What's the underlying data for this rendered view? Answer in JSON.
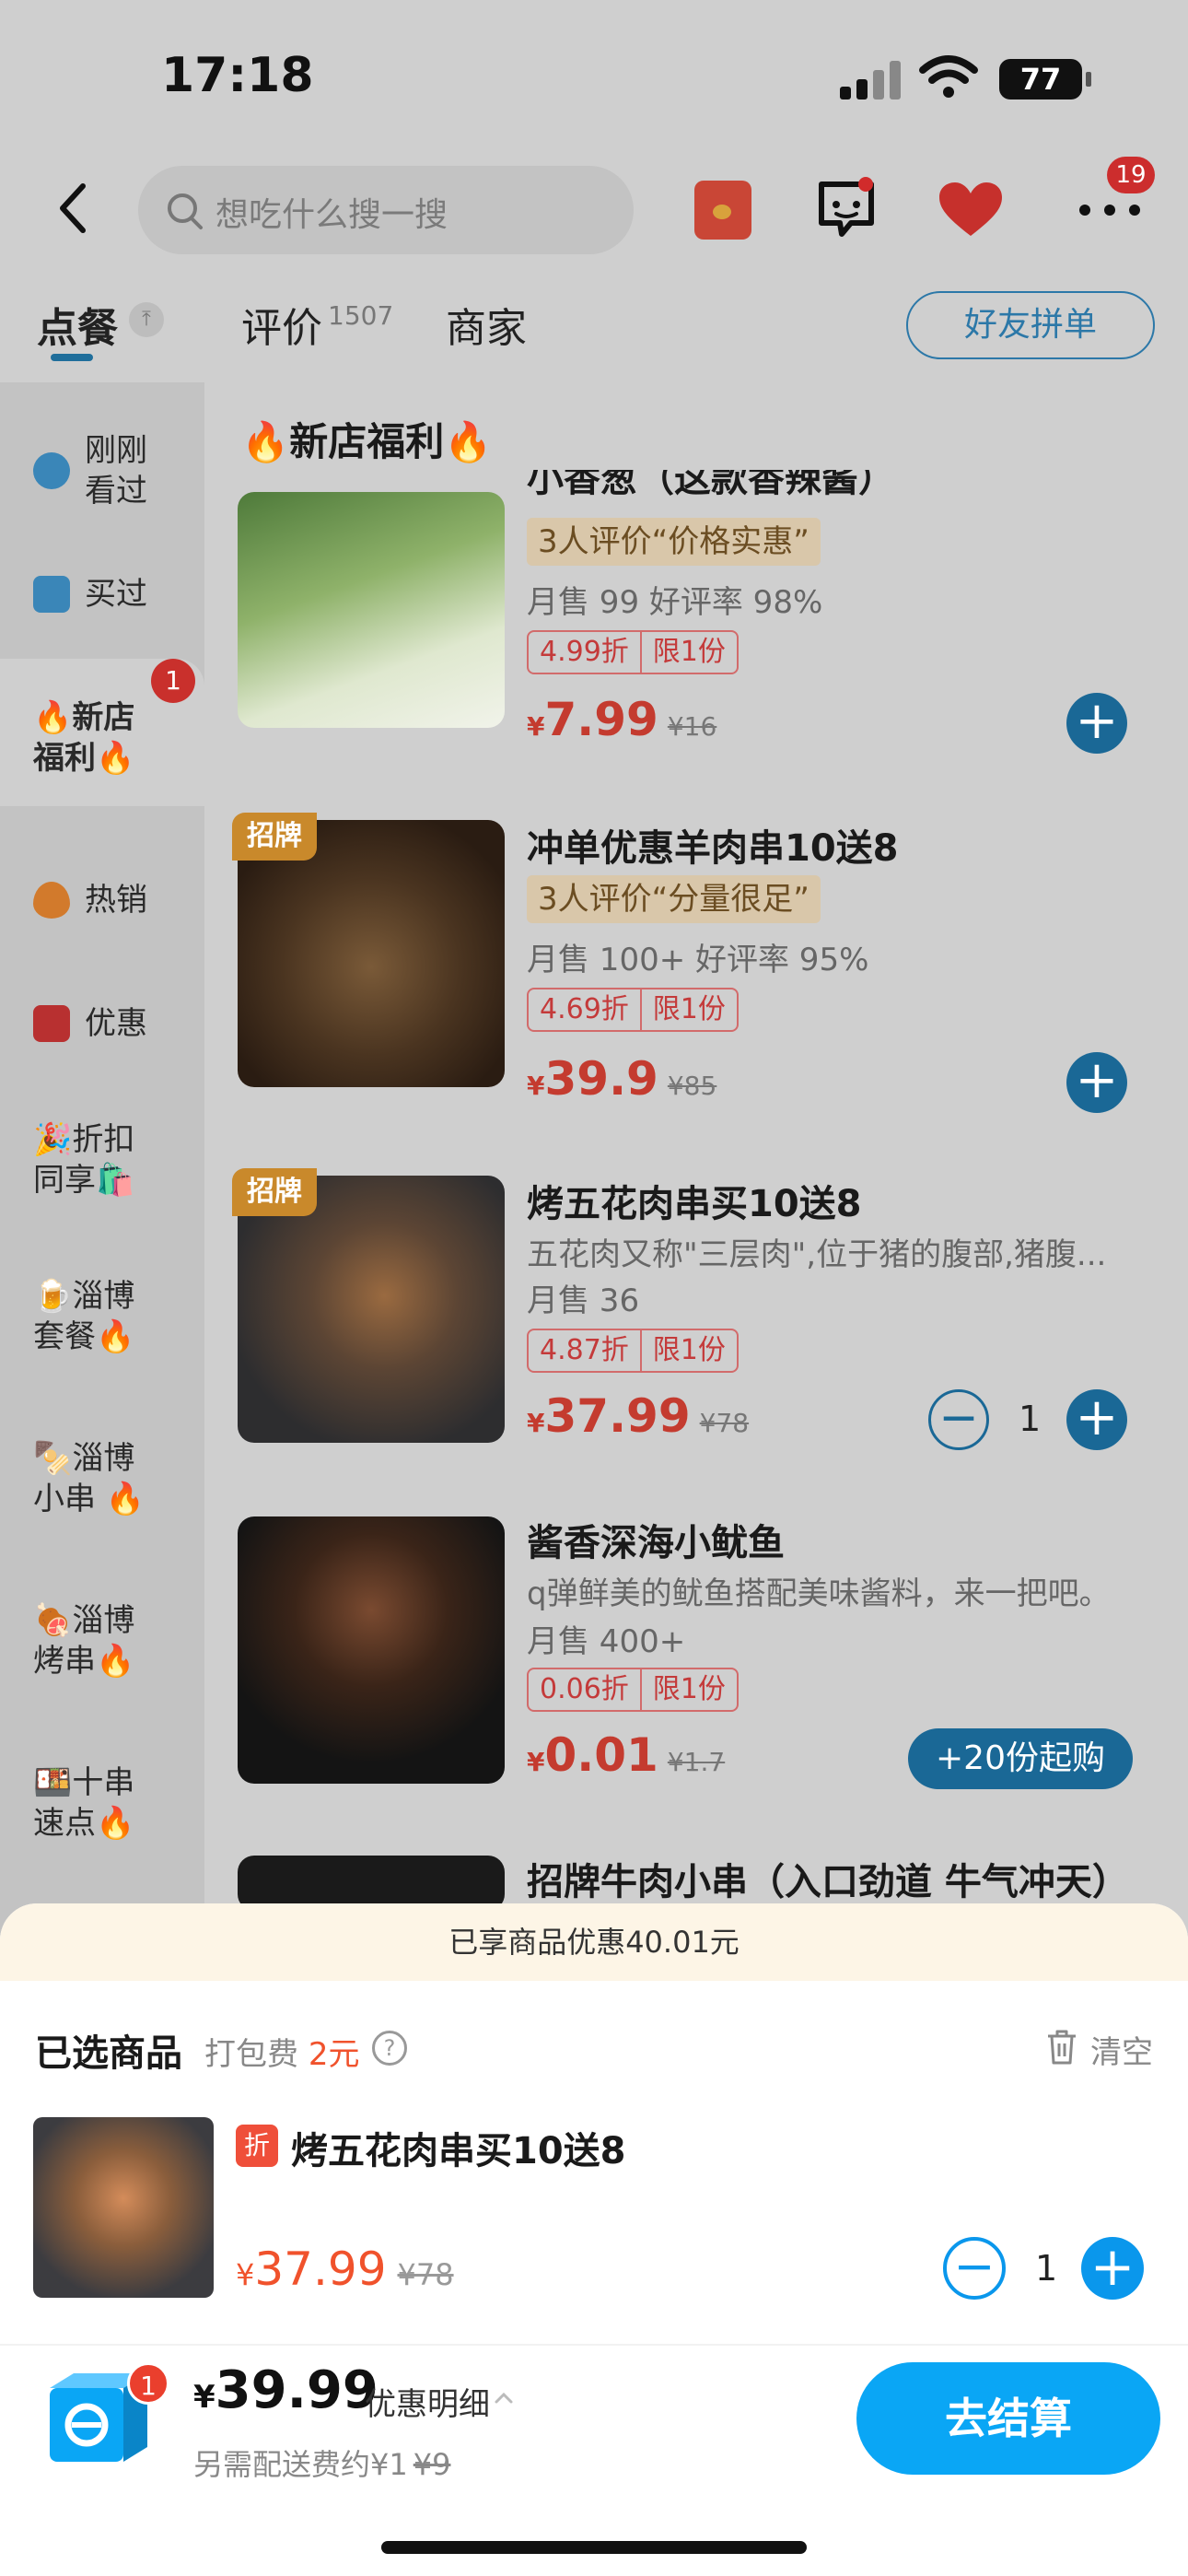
{
  "status_bar": {
    "time": "17:18",
    "battery": "77"
  },
  "header": {
    "search_placeholder": "想吃什么搜一搜",
    "notification_count": "19"
  },
  "tabs": {
    "order": "点餐",
    "review": "评价",
    "review_count": "1507",
    "merchant": "商家",
    "friend_group": "好友拼单"
  },
  "sidebar": {
    "items": [
      {
        "label": "刚刚\n看过",
        "icon": "eye-icon"
      },
      {
        "label": "买过",
        "icon": "bag-icon"
      },
      {
        "label": "🔥新店\n福利🔥",
        "icon": "",
        "badge": "1"
      },
      {
        "label": "热销",
        "icon": "flame-icon"
      },
      {
        "label": "优惠",
        "icon": "coupon-icon"
      },
      {
        "label": "🎉折扣\n同享🛍️",
        "icon": ""
      },
      {
        "label": "🍺淄博\n套餐🔥",
        "icon": ""
      },
      {
        "label": "🍢淄博\n小串 🔥",
        "icon": ""
      },
      {
        "label": "🍖淄博\n烤串🔥",
        "icon": ""
      },
      {
        "label": "🍱十串\n速点🔥",
        "icon": ""
      }
    ]
  },
  "section_title": "🔥新店福利🔥",
  "products": [
    {
      "name": "小香葱（这款香辣酱）",
      "tag": "3人评价“价格实惠”",
      "sales": "月售 99 好评率 98%",
      "discount": "4.99折",
      "limit": "限1份",
      "price": "7.99",
      "original": "¥16"
    },
    {
      "badge": "招牌",
      "name": "冲单优惠羊肉串10送8",
      "tag": "3人评价“分量很足”",
      "sales": "月售 100+ 好评率 95%",
      "discount": "4.69折",
      "limit": "限1份",
      "price": "39.9",
      "original": "¥85"
    },
    {
      "badge": "招牌",
      "name": "烤五花肉串买10送8",
      "desc": "五花肉又称\"三层肉\",位于猪的腹部,猪腹...",
      "sales": "月售 36",
      "discount": "4.87折",
      "limit": "限1份",
      "price": "37.99",
      "original": "¥78",
      "qty": "1"
    },
    {
      "name": "酱香深海小鱿鱼",
      "desc": "q弹鲜美的鱿鱼搭配美味酱料，来一把吧。",
      "sales": "月售 400+",
      "discount": "0.06折",
      "limit": "限1份",
      "price": "0.01",
      "original": "¥1.7",
      "min_order": "+20份起购"
    },
    {
      "name": "招牌牛肉小串（入口劲道 牛气冲天）"
    }
  ],
  "currency": "¥",
  "cart": {
    "banner": "已享商品优惠40.01元",
    "title": "已选商品",
    "pack_fee_label": "打包费",
    "pack_fee_value": "2元",
    "clear": "清空",
    "item": {
      "discount_tag": "折",
      "name": "烤五花肉串买10送8",
      "price": "37.99",
      "original": "¥78",
      "qty": "1"
    },
    "badge": "1",
    "total": "39.99",
    "detail": "优惠明细",
    "delivery_label": "另需配送费约¥1",
    "delivery_original": "¥9",
    "checkout": "去结算"
  },
  "colors": {
    "accent": "#0aa6f5",
    "price": "#f0522c",
    "dim_accent": "#1a6896"
  }
}
